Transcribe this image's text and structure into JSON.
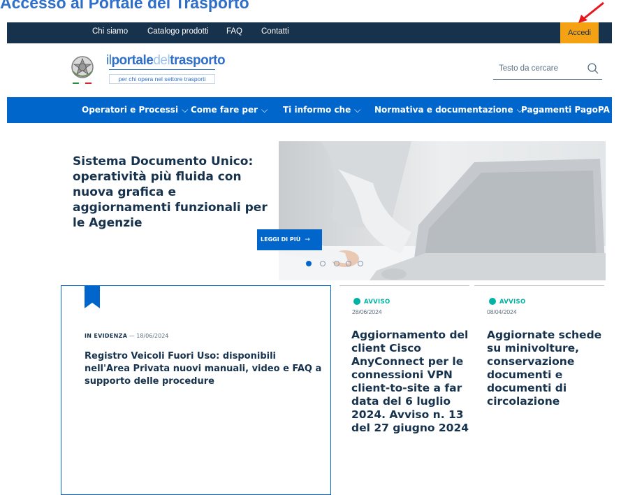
{
  "doc_title": "Accesso al Portale del Trasporto",
  "topbar": {
    "links": [
      "Chi siamo",
      "Catalogo prodotti",
      "FAQ",
      "Contatti"
    ],
    "login": "Accedi",
    "bg_color": "#17324d",
    "login_color": "#f5a114"
  },
  "logo": {
    "il": "il",
    "portale": "portale",
    "del": "del",
    "trasporto": "trasporto",
    "tagline": "per chi opera nel settore trasporti"
  },
  "search": {
    "placeholder": "Testo da cercare",
    "icon": "search-icon"
  },
  "nav": {
    "items": [
      "Operatori e Processi",
      "Come fare per",
      "Ti informo che",
      "Normativa e documentazione",
      "Pagamenti PagoPA"
    ],
    "chevron": "⌵",
    "bg_color": "#0066cc"
  },
  "hero": {
    "title": "Sistema Documento Unico: operatività più fluida con nuova grafica e aggiornamenti funzionali per le Agenzie",
    "cta": "LEGGI DI PIÙ",
    "cta_arrow": "→",
    "slides": 5,
    "active_slide": 1
  },
  "featured": {
    "category": "IN EVIDENZA",
    "date_sep": " — ",
    "date": "18/06/2024",
    "title": "Registro Veicoli Fuori Uso: disponibili nell'Area Privata nuovi manuali, video e FAQ a supporto delle procedure"
  },
  "news": [
    {
      "badge": "AVVISO",
      "date": "28/06/2024",
      "title": "Aggiornamento del client Cisco AnyConnect per le connessioni VPN client-to-site a far data del 6 luglio 2024. Avviso n. 13 del 27 giugno 2024"
    },
    {
      "badge": "AVVISO",
      "date": "08/04/2024",
      "title": "Aggiornate schede su minivolture, conservazione documenti e documenti di circolazione"
    }
  ],
  "accent_color": "#0066cc",
  "badge_color": "#00b3a4",
  "annotation_arrow_color": "#e8161b"
}
